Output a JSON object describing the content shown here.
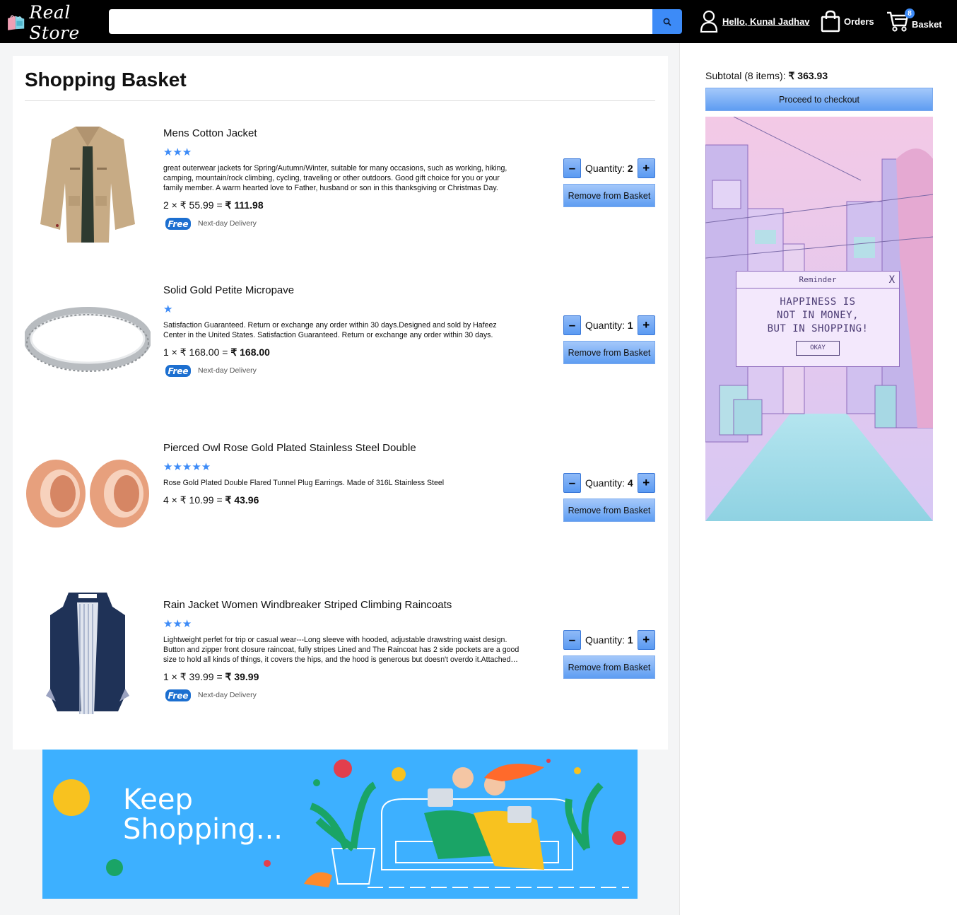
{
  "header": {
    "logo_text": "Real Store",
    "search_placeholder": "",
    "user_greeting": "Hello, Kunal Jadhav",
    "orders_label": "Orders",
    "basket_label": "Basket",
    "basket_count": "8"
  },
  "basket": {
    "title": "Shopping Basket",
    "items": [
      {
        "name": "Mens Cotton Jacket",
        "rating": 3,
        "stars": "★★★",
        "description": "great outerwear jackets for Spring/Autumn/Winter, suitable for many occasions, such as working, hiking, camping, mountain/rock climbing, cycling, traveling or other outdoors. Good gift choice for you or your family member. A warm hearted love to Father, husband or son in this thanksgiving or Christmas Day.",
        "price_expr": "2 × ₹ 55.99 = ",
        "price_total": "₹ 111.98",
        "free_delivery": true,
        "delivery_text": "Next-day Delivery",
        "quantity_label": "Quantity: ",
        "quantity": "2",
        "remove_label": "Remove from Basket"
      },
      {
        "name": "Solid Gold Petite Micropave",
        "rating": 1,
        "stars": "★",
        "description": "Satisfaction Guaranteed. Return or exchange any order within 30 days.Designed and sold by Hafeez Center in the United States. Satisfaction Guaranteed. Return or exchange any order within 30 days.",
        "price_expr": "1 × ₹ 168.00 = ",
        "price_total": "₹ 168.00",
        "free_delivery": true,
        "delivery_text": "Next-day Delivery",
        "quantity_label": "Quantity: ",
        "quantity": "1",
        "remove_label": "Remove from Basket"
      },
      {
        "name": "Pierced Owl Rose Gold Plated Stainless Steel Double",
        "rating": 5,
        "stars": "★★★★★",
        "description": "Rose Gold Plated Double Flared Tunnel Plug Earrings. Made of 316L Stainless Steel",
        "price_expr": "4 × ₹ 10.99 = ",
        "price_total": "₹ 43.96",
        "free_delivery": false,
        "quantity_label": "Quantity: ",
        "quantity": "4",
        "remove_label": "Remove from Basket"
      },
      {
        "name": "Rain Jacket Women Windbreaker Striped Climbing Raincoats",
        "rating": 3,
        "stars": "★★★",
        "description": "Lightweight perfet for trip or casual wear---Long sleeve with hooded, adjustable drawstring waist design. Button and zipper front closure raincoat, fully stripes Lined and The Raincoat has 2 side pockets are a good size to hold all kinds of things, it covers the hips, and the hood is generous but doesn't overdo it.Attached…",
        "price_expr": "1 × ₹ 39.99 = ",
        "price_total": "₹ 39.99",
        "free_delivery": true,
        "delivery_text": "Next-day Delivery",
        "quantity_label": "Quantity: ",
        "quantity": "1",
        "remove_label": "Remove from Basket"
      }
    ]
  },
  "banner": {
    "line1": "Keep",
    "line2": "Shopping..."
  },
  "sidebar": {
    "subtotal_label": "Subtotal (8 items): ",
    "subtotal_value": "₹ 363.93",
    "checkout_label": "Proceed to checkout",
    "ad": {
      "title": "Reminder",
      "close": "X",
      "line1": "HAPPINESS IS",
      "line2": "NOT IN MONEY,",
      "line3": "BUT IN SHOPPING!",
      "ok": "OKAY"
    }
  },
  "colors": {
    "accent": "#3d8bf7",
    "header_bg": "#000000",
    "star": "#3d8bf7",
    "banner_bg": "#3db0ff"
  }
}
